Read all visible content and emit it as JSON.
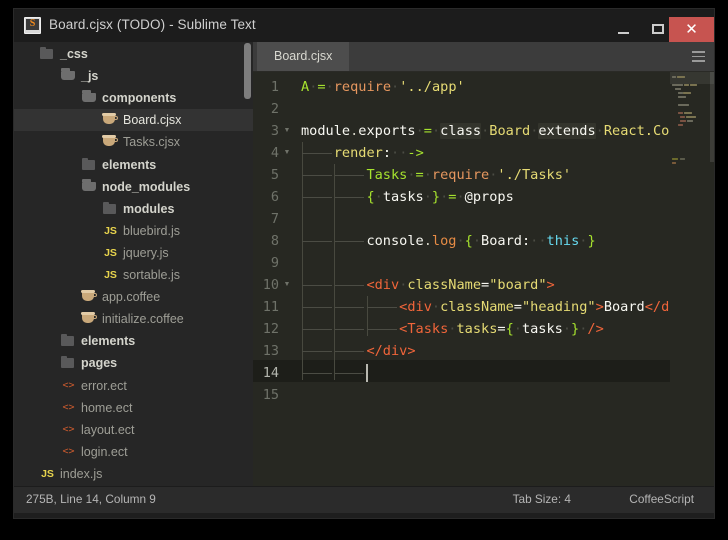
{
  "window": {
    "title": "Board.cjsx (TODO) - Sublime Text",
    "app_icon": "sublime-text-icon",
    "minimize_label": "—",
    "maximize_label": "□",
    "close_label": "✕"
  },
  "sidebar": {
    "items": [
      {
        "label": "_css",
        "icon": "folder-closed-icon",
        "type": "folder",
        "indent": 0,
        "selected": false
      },
      {
        "label": "_js",
        "icon": "folder-open-icon",
        "type": "folder",
        "indent": 1,
        "selected": false
      },
      {
        "label": "components",
        "icon": "folder-open-icon",
        "type": "folder",
        "indent": 2,
        "selected": false
      },
      {
        "label": "Board.cjsx",
        "icon": "coffee-icon",
        "type": "file",
        "indent": 3,
        "selected": true
      },
      {
        "label": "Tasks.cjsx",
        "icon": "coffee-icon",
        "type": "file",
        "indent": 3,
        "selected": false
      },
      {
        "label": "elements",
        "icon": "folder-closed-icon",
        "type": "folder",
        "indent": 2,
        "selected": false
      },
      {
        "label": "node_modules",
        "icon": "folder-open-icon",
        "type": "folder",
        "indent": 2,
        "selected": false
      },
      {
        "label": "modules",
        "icon": "folder-closed-icon",
        "type": "folder",
        "indent": 3,
        "selected": false
      },
      {
        "label": "bluebird.js",
        "icon": "js-icon",
        "type": "file",
        "indent": 3,
        "selected": false
      },
      {
        "label": "jquery.js",
        "icon": "js-icon",
        "type": "file",
        "indent": 3,
        "selected": false
      },
      {
        "label": "sortable.js",
        "icon": "js-icon",
        "type": "file",
        "indent": 3,
        "selected": false
      },
      {
        "label": "app.coffee",
        "icon": "coffee-icon",
        "type": "file",
        "indent": 2,
        "selected": false
      },
      {
        "label": "initialize.coffee",
        "icon": "coffee-icon",
        "type": "file",
        "indent": 2,
        "selected": false
      },
      {
        "label": "elements",
        "icon": "folder-closed-icon",
        "type": "folder",
        "indent": 1,
        "selected": false
      },
      {
        "label": "pages",
        "icon": "folder-closed-icon",
        "type": "folder",
        "indent": 1,
        "selected": false
      },
      {
        "label": "error.ect",
        "icon": "ect-icon",
        "type": "file",
        "indent": 1,
        "selected": false
      },
      {
        "label": "home.ect",
        "icon": "ect-icon",
        "type": "file",
        "indent": 1,
        "selected": false
      },
      {
        "label": "layout.ect",
        "icon": "ect-icon",
        "type": "file",
        "indent": 1,
        "selected": false
      },
      {
        "label": "login.ect",
        "icon": "ect-icon",
        "type": "file",
        "indent": 1,
        "selected": false
      },
      {
        "label": "index.js",
        "icon": "js-icon",
        "type": "file",
        "indent": 0,
        "selected": false
      }
    ]
  },
  "editor": {
    "tabs": [
      {
        "label": "Board.cjsx",
        "active": true
      }
    ],
    "tab_menu_icon": "hamburger-menu-icon",
    "active_line": 14,
    "line_numbers": [
      "1",
      "2",
      "3",
      "4",
      "5",
      "6",
      "7",
      "8",
      "9",
      "10",
      "11",
      "12",
      "13",
      "14",
      "15"
    ],
    "fold_markers": [
      3,
      4,
      10
    ],
    "lines": [
      {
        "n": 1,
        "text": "A = require '../app'"
      },
      {
        "n": 2,
        "text": ""
      },
      {
        "n": 3,
        "text": "module.exports = class Board extends React.Com"
      },
      {
        "n": 4,
        "text": "    render: ->"
      },
      {
        "n": 5,
        "text": "        Tasks = require './Tasks'"
      },
      {
        "n": 6,
        "text": "        { tasks } = @props"
      },
      {
        "n": 7,
        "text": ""
      },
      {
        "n": 8,
        "text": "        console.log { Board: this }"
      },
      {
        "n": 9,
        "text": ""
      },
      {
        "n": 10,
        "text": "        <div className=\"board\">"
      },
      {
        "n": 11,
        "text": "            <div className=\"heading\">Board</di"
      },
      {
        "n": 12,
        "text": "            <Tasks tasks={ tasks } />"
      },
      {
        "n": 13,
        "text": "        </div>"
      },
      {
        "n": 14,
        "text": ""
      },
      {
        "n": 15,
        "text": ""
      }
    ]
  },
  "statusbar": {
    "position": "275B, Line 14, Column 9",
    "tab_size": "Tab Size: 4",
    "syntax": "CoffeeScript"
  },
  "colors": {
    "background": "#272822",
    "sidebar_bg": "#262626",
    "titlebar_bg": "#1c1c1c",
    "close_button": "#c75450",
    "accent_green": "#a6e22e",
    "accent_yellow": "#e6db74",
    "accent_orange": "#f0653a",
    "accent_blue": "#66d9ef",
    "selection": "#333333"
  }
}
